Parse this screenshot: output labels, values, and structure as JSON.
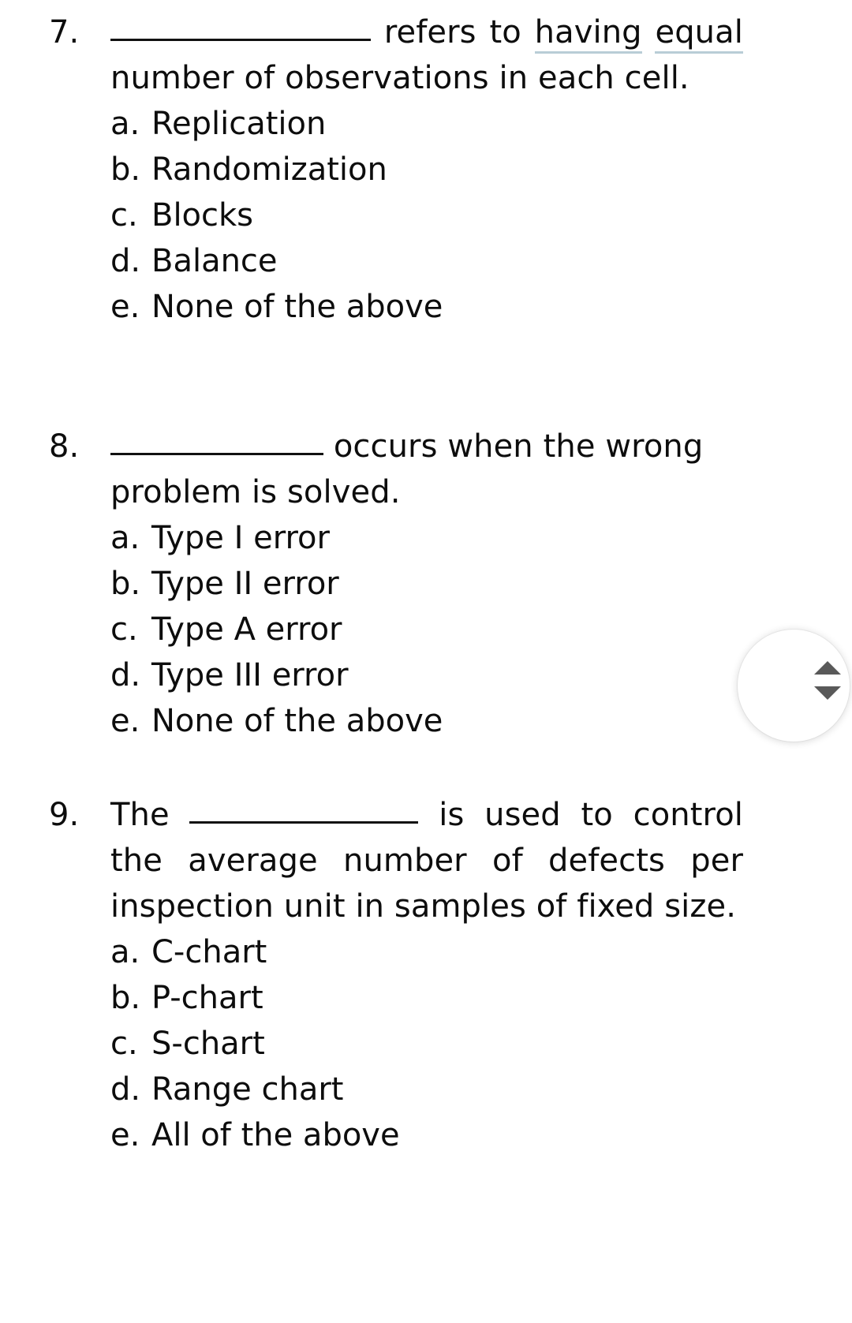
{
  "document": {
    "background_color": "#ffffff",
    "text_color": "#0d0d0d",
    "spellcheck_underline_color": "#b9cdd6"
  },
  "questions": [
    {
      "number": "7.",
      "stem_before_blank": "",
      "stem_part_1": "refers to ",
      "stem_underlined_1": "having",
      "stem_part_2": " ",
      "stem_underlined_2": "equal",
      "stem_part_3": " number of observations in each cell.",
      "options": [
        {
          "letter": "a.",
          "text": "Replication"
        },
        {
          "letter": "b.",
          "text": "Randomization"
        },
        {
          "letter": "c.",
          "text": "Blocks"
        },
        {
          "letter": "d.",
          "text": "Balance"
        },
        {
          "letter": "e.",
          "text": "None of the above"
        }
      ]
    },
    {
      "number": "8.",
      "stem_before_blank": "",
      "stem_after_blank": "occurs when the wrong problem is solved.",
      "options": [
        {
          "letter": "a.",
          "text": "Type I error"
        },
        {
          "letter": "b.",
          "text": "Type II error"
        },
        {
          "letter": "c.",
          "text": "Type A error"
        },
        {
          "letter": "d.",
          "text": "Type III error"
        },
        {
          "letter": "e.",
          "text": "None of the above"
        }
      ]
    },
    {
      "number": "9.",
      "stem_before_blank": "The ",
      "stem_after_blank": " is used to control the average number of defects per inspection unit in samples of fixed size.",
      "options": [
        {
          "letter": "a.",
          "text": "C-chart"
        },
        {
          "letter": "b.",
          "text": "P-chart"
        },
        {
          "letter": "c.",
          "text": "S-chart"
        },
        {
          "letter": "d.",
          "text": "Range chart"
        },
        {
          "letter": "e.",
          "text": "All of the above"
        }
      ]
    }
  ],
  "scroll_widget": {
    "up_icon": "triangle-up-icon",
    "down_icon": "triangle-down-icon"
  }
}
